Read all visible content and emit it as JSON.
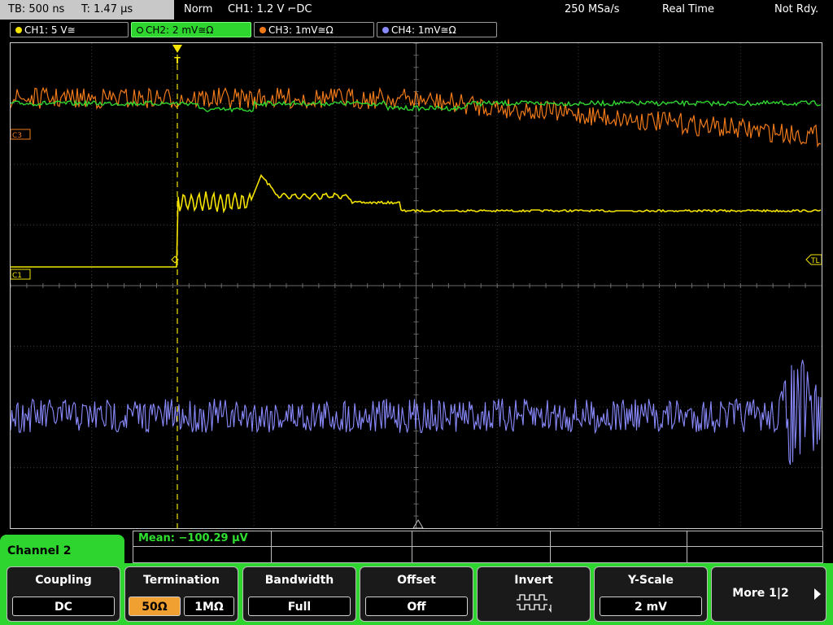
{
  "topbar": {
    "timebase": "TB: 500 ns",
    "trigger_time": "T: 1.47 µs",
    "mode": "Norm",
    "trigger_source": "CH1: 1.2 V ⌐DC",
    "sample_rate": "250 MSa/s",
    "acq_mode": "Real Time",
    "status": "Not Rdy."
  },
  "channels": [
    {
      "label": "CH1: 5 V≅",
      "color": "#f5e400"
    },
    {
      "label": "CH2: 2 mV≅Ω",
      "color": "#2fd52f"
    },
    {
      "label": "CH3: 1mV≅Ω",
      "color": "#f07a1a"
    },
    {
      "label": "CH4: 1mV≅Ω",
      "color": "#8a8aff"
    }
  ],
  "markers": {
    "c3": "C3",
    "c1": "C1",
    "tl": "TL",
    "trigger": "T"
  },
  "measurement": {
    "mean": "Mean: −100.29 µV"
  },
  "menu": {
    "title": "Channel 2",
    "coupling": {
      "title": "Coupling",
      "value": "DC"
    },
    "termination": {
      "title": "Termination",
      "options": [
        "50Ω",
        "1MΩ"
      ],
      "selected": "50Ω"
    },
    "bandwidth": {
      "title": "Bandwidth",
      "value": "Full"
    },
    "offset": {
      "title": "Offset",
      "value": "Off"
    },
    "invert": {
      "title": "Invert",
      "icon": "invert-pulse-icon"
    },
    "yscale": {
      "title": "Y-Scale",
      "value": "2 mV"
    },
    "more": {
      "title": "More 1|2"
    }
  }
}
